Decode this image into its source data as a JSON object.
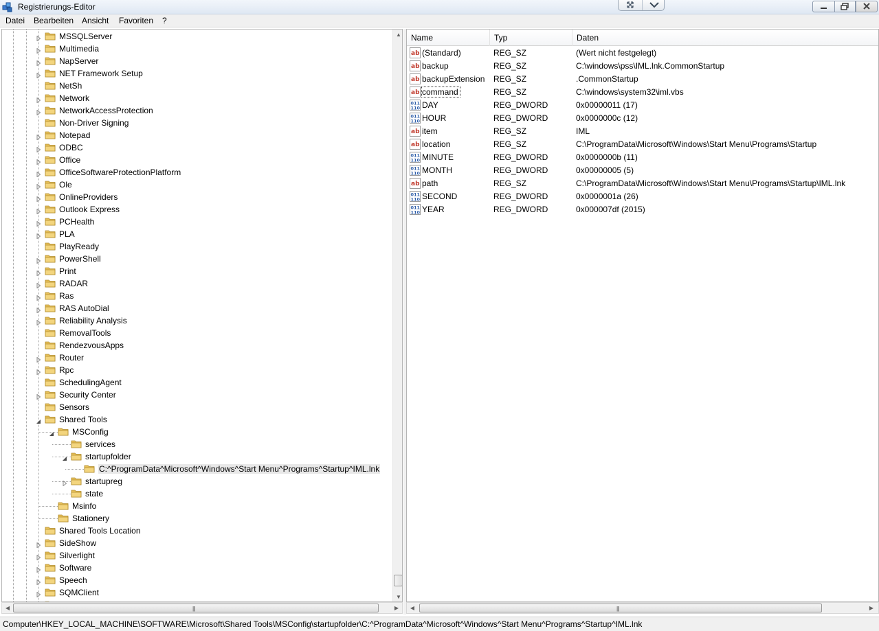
{
  "window": {
    "title": "Registrierungs-Editor"
  },
  "menu": [
    "Datei",
    "Bearbeiten",
    "Ansicht",
    "Favoriten",
    "?"
  ],
  "tree": [
    {
      "label": "MSSQLServer",
      "depth": 0,
      "toggle": "collapsed"
    },
    {
      "label": "Multimedia",
      "depth": 0,
      "toggle": "collapsed"
    },
    {
      "label": "NapServer",
      "depth": 0,
      "toggle": "collapsed"
    },
    {
      "label": "NET Framework Setup",
      "depth": 0,
      "toggle": "collapsed"
    },
    {
      "label": "NetSh",
      "depth": 0,
      "toggle": "none"
    },
    {
      "label": "Network",
      "depth": 0,
      "toggle": "collapsed"
    },
    {
      "label": "NetworkAccessProtection",
      "depth": 0,
      "toggle": "collapsed"
    },
    {
      "label": "Non-Driver Signing",
      "depth": 0,
      "toggle": "none"
    },
    {
      "label": "Notepad",
      "depth": 0,
      "toggle": "collapsed"
    },
    {
      "label": "ODBC",
      "depth": 0,
      "toggle": "collapsed"
    },
    {
      "label": "Office",
      "depth": 0,
      "toggle": "collapsed"
    },
    {
      "label": "OfficeSoftwareProtectionPlatform",
      "depth": 0,
      "toggle": "collapsed"
    },
    {
      "label": "Ole",
      "depth": 0,
      "toggle": "collapsed"
    },
    {
      "label": "OnlineProviders",
      "depth": 0,
      "toggle": "collapsed"
    },
    {
      "label": "Outlook Express",
      "depth": 0,
      "toggle": "collapsed"
    },
    {
      "label": "PCHealth",
      "depth": 0,
      "toggle": "collapsed"
    },
    {
      "label": "PLA",
      "depth": 0,
      "toggle": "collapsed"
    },
    {
      "label": "PlayReady",
      "depth": 0,
      "toggle": "none"
    },
    {
      "label": "PowerShell",
      "depth": 0,
      "toggle": "collapsed"
    },
    {
      "label": "Print",
      "depth": 0,
      "toggle": "collapsed"
    },
    {
      "label": "RADAR",
      "depth": 0,
      "toggle": "collapsed"
    },
    {
      "label": "Ras",
      "depth": 0,
      "toggle": "collapsed"
    },
    {
      "label": "RAS AutoDial",
      "depth": 0,
      "toggle": "collapsed"
    },
    {
      "label": "Reliability Analysis",
      "depth": 0,
      "toggle": "collapsed"
    },
    {
      "label": "RemovalTools",
      "depth": 0,
      "toggle": "none"
    },
    {
      "label": "RendezvousApps",
      "depth": 0,
      "toggle": "none"
    },
    {
      "label": "Router",
      "depth": 0,
      "toggle": "collapsed"
    },
    {
      "label": "Rpc",
      "depth": 0,
      "toggle": "collapsed"
    },
    {
      "label": "SchedulingAgent",
      "depth": 0,
      "toggle": "none"
    },
    {
      "label": "Security Center",
      "depth": 0,
      "toggle": "collapsed"
    },
    {
      "label": "Sensors",
      "depth": 0,
      "toggle": "none"
    },
    {
      "label": "Shared Tools",
      "depth": 0,
      "toggle": "expanded"
    },
    {
      "label": "MSConfig",
      "depth": 1,
      "toggle": "expanded"
    },
    {
      "label": "services",
      "depth": 2,
      "toggle": "none"
    },
    {
      "label": "startupfolder",
      "depth": 2,
      "toggle": "expanded"
    },
    {
      "label": "C:^ProgramData^Microsoft^Windows^Start Menu^Programs^Startup^IML.lnk",
      "depth": 3,
      "toggle": "none",
      "selected": true
    },
    {
      "label": "startupreg",
      "depth": 2,
      "toggle": "collapsed"
    },
    {
      "label": "state",
      "depth": 2,
      "toggle": "none"
    },
    {
      "label": "Msinfo",
      "depth": 1,
      "toggle": "none"
    },
    {
      "label": "Stationery",
      "depth": 1,
      "toggle": "none"
    },
    {
      "label": "Shared Tools Location",
      "depth": 0,
      "toggle": "none"
    },
    {
      "label": "SideShow",
      "depth": 0,
      "toggle": "collapsed"
    },
    {
      "label": "Silverlight",
      "depth": 0,
      "toggle": "collapsed"
    },
    {
      "label": "Software",
      "depth": 0,
      "toggle": "collapsed"
    },
    {
      "label": "Speech",
      "depth": 0,
      "toggle": "collapsed"
    },
    {
      "label": "SQMClient",
      "depth": 0,
      "toggle": "collapsed"
    },
    {
      "label": "",
      "depth": 0,
      "toggle": "collapsed"
    }
  ],
  "columns": {
    "name": "Name",
    "type": "Typ",
    "data": "Daten"
  },
  "values": [
    {
      "name": "(Standard)",
      "type": "REG_SZ",
      "data": "(Wert nicht festgelegt)",
      "icon": "string-value-icon"
    },
    {
      "name": "backup",
      "type": "REG_SZ",
      "data": "C:\\windows\\pss\\IML.lnk.CommonStartup",
      "icon": "string-value-icon"
    },
    {
      "name": "backupExtension",
      "type": "REG_SZ",
      "data": ".CommonStartup",
      "icon": "string-value-icon"
    },
    {
      "name": "command",
      "type": "REG_SZ",
      "data": "C:\\windows\\system32\\iml.vbs",
      "icon": "string-value-icon",
      "focused": true
    },
    {
      "name": "DAY",
      "type": "REG_DWORD",
      "data": "0x00000011 (17)",
      "icon": "binary-value-icon"
    },
    {
      "name": "HOUR",
      "type": "REG_DWORD",
      "data": "0x0000000c (12)",
      "icon": "binary-value-icon"
    },
    {
      "name": "item",
      "type": "REG_SZ",
      "data": "IML",
      "icon": "string-value-icon"
    },
    {
      "name": "location",
      "type": "REG_SZ",
      "data": "C:\\ProgramData\\Microsoft\\Windows\\Start Menu\\Programs\\Startup",
      "icon": "string-value-icon"
    },
    {
      "name": "MINUTE",
      "type": "REG_DWORD",
      "data": "0x0000000b (11)",
      "icon": "binary-value-icon"
    },
    {
      "name": "MONTH",
      "type": "REG_DWORD",
      "data": "0x00000005 (5)",
      "icon": "binary-value-icon"
    },
    {
      "name": "path",
      "type": "REG_SZ",
      "data": "C:\\ProgramData\\Microsoft\\Windows\\Start Menu\\Programs\\Startup\\IML.lnk",
      "icon": "string-value-icon"
    },
    {
      "name": "SECOND",
      "type": "REG_DWORD",
      "data": "0x0000001a (26)",
      "icon": "binary-value-icon"
    },
    {
      "name": "YEAR",
      "type": "REG_DWORD",
      "data": "0x000007df (2015)",
      "icon": "binary-value-icon"
    }
  ],
  "status": {
    "path": "Computer\\HKEY_LOCAL_MACHINE\\SOFTWARE\\Microsoft\\Shared Tools\\MSConfig\\startupfolder\\C:^ProgramData^Microsoft^Windows^Start Menu^Programs^Startup^IML.lnk"
  },
  "colors": {
    "folder": "#e8c15a",
    "string_icon": "#c0392b",
    "binary_icon": "#2f5faa",
    "selection": "#e8e8e8"
  }
}
